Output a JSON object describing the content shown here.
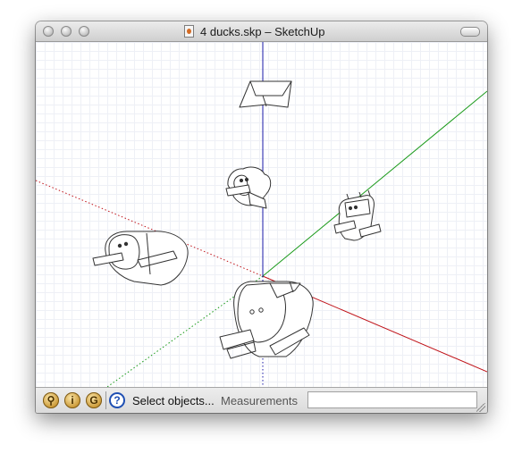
{
  "window": {
    "title": "4 ducks.skp – SketchUp"
  },
  "statusbar": {
    "status_text": "Select objects...",
    "measurements_label": "Measurements",
    "measurements_value": "",
    "icons": [
      "geo-location-icon",
      "credits-icon",
      "google-sign-in-icon",
      "help-icon"
    ]
  },
  "colors": {
    "red_axis": "#c0141a",
    "green_axis": "#1a9a1a",
    "blue_axis": "#1818a8",
    "grid": "#eef0f6",
    "help_blue": "#1e4fb3"
  }
}
